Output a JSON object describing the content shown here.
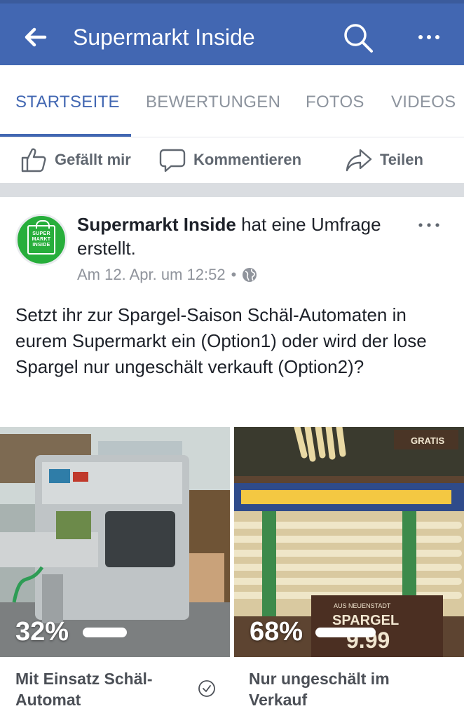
{
  "header": {
    "title": "Supermarkt Inside",
    "back_icon": "arrow-left-icon",
    "search_icon": "search-icon",
    "more_icon": "more-dots-icon",
    "background": "#4267b2"
  },
  "tabs": [
    {
      "label": "STARTSEITE",
      "active": true
    },
    {
      "label": "BEWERTUNGEN",
      "active": false
    },
    {
      "label": "FOTOS",
      "active": false
    },
    {
      "label": "VIDEOS",
      "active": false
    }
  ],
  "actions": [
    {
      "label": "Gefällt mir",
      "icon": "thumbs-up-icon"
    },
    {
      "label": "Kommentieren",
      "icon": "comment-icon"
    },
    {
      "label": "Teilen",
      "icon": "share-icon"
    }
  ],
  "post": {
    "author": "Supermarkt Inside",
    "action_text": "hat eine Umfrage erstellt.",
    "avatar_text": [
      "SUPER",
      "MARKT",
      "INSIDE"
    ],
    "avatar_color": "#27ae3b",
    "timestamp": "Am 12. Apr. um 12:52",
    "separator": "•",
    "privacy_icon": "globe-icon",
    "more_icon": "more-dots-icon",
    "text": "Setzt ihr zur Spargel-Saison Schäl-Automaten in eurem Supermarkt ein (Option1) oder wird der lose Spargel nur ungeschält verkauft (Option2)?"
  },
  "poll": {
    "options": [
      {
        "percent_label": "32%",
        "percent": 32,
        "label": "Mit Einsatz Schäl-Automat",
        "checked": true,
        "image": "peeling-machine-photo"
      },
      {
        "percent_label": "68%",
        "percent": 68,
        "label": "Nur ungeschält im Verkauf",
        "checked": false,
        "image": "asparagus-display-photo"
      }
    ]
  }
}
